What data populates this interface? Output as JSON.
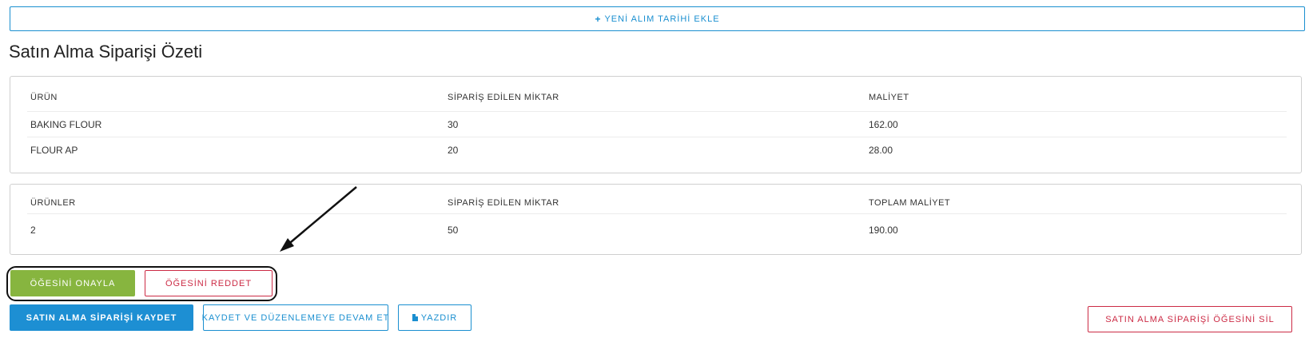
{
  "actions": {
    "add_date_label": "YENİ ALIM TARİHİ EKLE",
    "approve_label": "ÖĞESİNİ ONAYLA",
    "reject_label": "ÖĞESİNİ REDDET",
    "save_label": "SATIN ALMA SİPARİŞİ KAYDET",
    "save_continue_label": "KAYDET VE DÜZENLEMEYE DEVAM ET",
    "print_label": "YAZDIR",
    "delete_label": "SATIN ALMA SİPARİŞİ ÖĞESİNİ SİL"
  },
  "page_title": "Satın Alma Siparişi Özeti",
  "items_table": {
    "headers": [
      "ÜRÜN",
      "SİPARİŞ EDİLEN MİKTAR",
      "MALİYET"
    ],
    "rows": [
      [
        "BAKING FLOUR",
        "30",
        "162.00"
      ],
      [
        "FLOUR AP",
        "20",
        "28.00"
      ]
    ]
  },
  "totals_table": {
    "headers": [
      "ÜRÜNLER",
      "SİPARİŞ EDİLEN MİKTAR",
      "TOPLAM MALİYET"
    ],
    "rows": [
      [
        "2",
        "50",
        "190.00"
      ]
    ]
  },
  "icons": {
    "add": "plus-icon",
    "print": "document-icon",
    "annotation": "arrow-annotation"
  },
  "colors": {
    "primary": "#1d8fd3",
    "success": "#87b53f",
    "danger": "#cc2b45",
    "border": "#cfcfcf"
  }
}
